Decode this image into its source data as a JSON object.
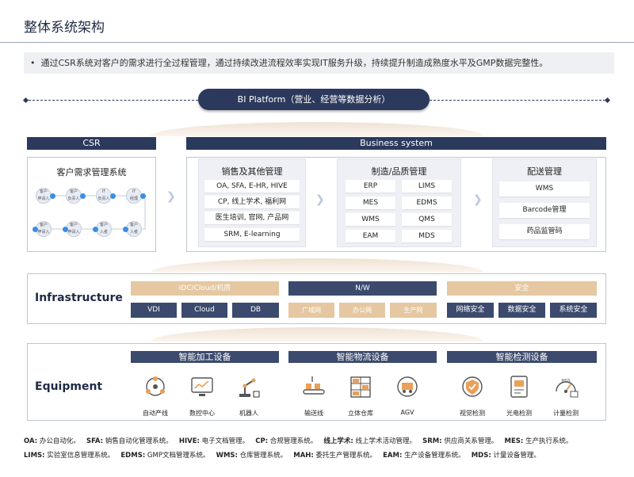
{
  "page": {
    "title": "整体系统架构",
    "intro": "通过CSR系统对客户的需求进行全过程管理，通过持续改进流程效率实现IT服务升级，持续提升制造成熟度水平及GMP数据完整性。"
  },
  "bi": {
    "label": "BI  Platform（营业、经营等数据分析）"
  },
  "csr": {
    "header": "CSR",
    "title": "客户需求管理系统",
    "flow_top": [
      "客户\n申请入",
      "客户\n负责人",
      "IT\n负责人",
      "IT\n经理"
    ],
    "flow_bottom": [
      "客户\n申请入",
      "客户\n申请入",
      "客户\n入者",
      "客户\n入者"
    ]
  },
  "business": {
    "header": "Business system",
    "sales": {
      "title": "销售及其他管理",
      "items": [
        "OA, SFA, E-HR, HIVE",
        "CP, 线上学术, 福利网",
        "医生培训, 官网, 产品网",
        "SRM, E-learning"
      ]
    },
    "manufacturing": {
      "title": "制造/品质管理",
      "items": [
        "ERP",
        "LIMS",
        "MES",
        "EDMS",
        "WMS",
        "QMS",
        "EAM",
        "MDS"
      ]
    },
    "delivery": {
      "title": "配送管理",
      "items": [
        "WMS",
        "Barcode管理",
        "药品监管码"
      ]
    }
  },
  "infrastructure": {
    "title": "Infrastructure",
    "groups": [
      {
        "header": "IDC/Cloud/机房",
        "items": [
          "VDI",
          "Cloud",
          "DB"
        ]
      },
      {
        "header": "N/W",
        "items": [
          "广域网",
          "办公网",
          "生产网"
        ]
      },
      {
        "header": "安全",
        "items": [
          "网络安全",
          "数据安全",
          "系统安全"
        ]
      }
    ]
  },
  "equipment": {
    "title": "Equipment",
    "groups": [
      {
        "header": "智能加工设备",
        "items": [
          "自动产线",
          "数控中心",
          "机器人"
        ]
      },
      {
        "header": "智能物流设备",
        "items": [
          "输送线",
          "立体仓库",
          "AGV"
        ]
      },
      {
        "header": "智能检测设备",
        "items": [
          "视觉检测",
          "光电检测",
          "计量检测"
        ]
      }
    ],
    "mds_icon_text": "MDS"
  },
  "legend": {
    "line1": [
      {
        "k": "OA:",
        "v": " 办公自动化。"
      },
      {
        "k": "SFA:",
        "v": " 销售自动化管理系统。"
      },
      {
        "k": "HIVE:",
        "v": " 电子文档管理。"
      },
      {
        "k": "CP:",
        "v": " 合规管理系统。"
      },
      {
        "k": "线上学术:",
        "v": " 线上学术活动管理。"
      },
      {
        "k": "SRM:",
        "v": " 供应商关系管理。"
      },
      {
        "k": "MES:",
        "v": " 生产执行系统。"
      }
    ],
    "line2": [
      {
        "k": "LIMS:",
        "v": " 实验室信息管理系统。"
      },
      {
        "k": "EDMS:",
        "v": " GMP文档管理系统。"
      },
      {
        "k": "WMS:",
        "v": " 仓库管理系统。"
      },
      {
        "k": "MAH:",
        "v": " 委托生产管理系统。"
      },
      {
        "k": "EAM:",
        "v": " 生产设备管理系统。"
      },
      {
        "k": "MDS:",
        "v": " 计量设备管理。"
      }
    ]
  },
  "colors": {
    "navy": "#2b3a5c",
    "tan": "#e5c7a1",
    "panel_bg": "#eef0f6"
  }
}
